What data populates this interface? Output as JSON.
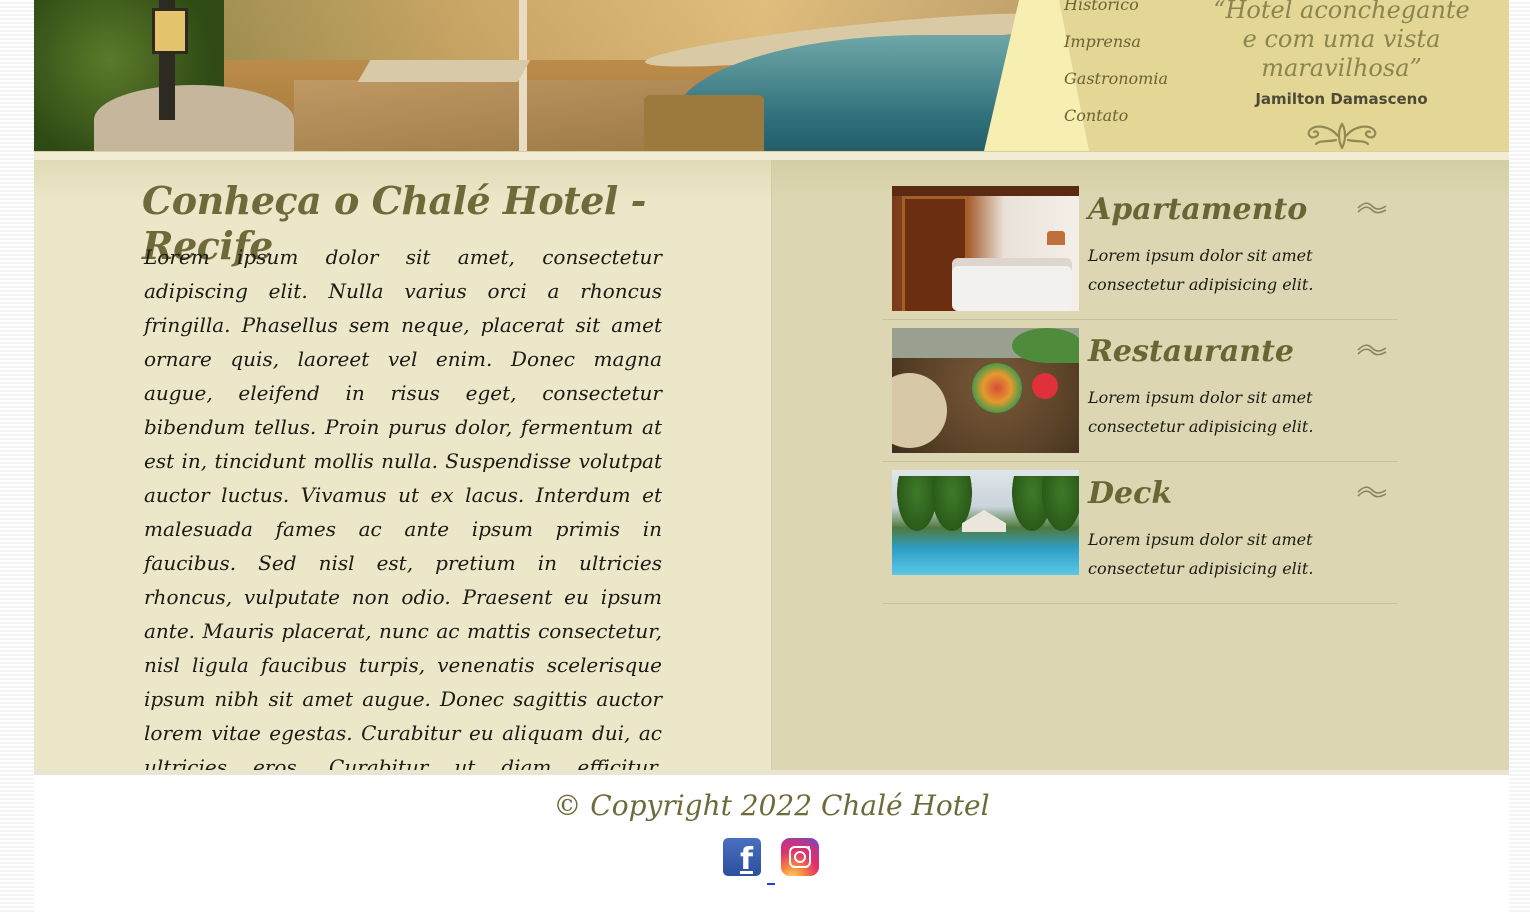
{
  "nav": {
    "items": [
      "Histórico",
      "Imprensa",
      "Gastronomia",
      "Contato"
    ]
  },
  "header": {
    "quote": "“Hotel aconchegante\ne com uma vista\nmaravilhosa”",
    "author": "Jamilton Damasceno"
  },
  "main": {
    "title": "Conheça o Chalé Hotel - Recife",
    "text": "Lorem ipsum dolor sit amet, consectetur adipiscing elit. Nulla varius orci a rhoncus fringilla. Phasellus sem neque, placerat sit amet ornare quis, laoreet vel enim. Donec magna augue, eleifend in risus eget, consectetur bibendum tellus. Proin purus dolor, fermentum at est in, tincidunt mollis nulla. Suspendisse volutpat auctor luctus. Vivamus ut ex lacus. Interdum et malesuada fames ac ante ipsum primis in faucibus. Sed nisl est, pretium in ultricies rhoncus, vulputate non odio. Praesent eu ipsum ante. Mauris placerat, nunc ac mattis consectetur, nisl ligula faucibus turpis, venenatis scelerisque ipsum nibh sit amet augue. Donec sagittis auctor lorem vitae egestas. Curabitur eu aliquam dui, ac ultricies eros. Curabitur ut diam efficitur, scelerisque elit eget, varius sapien. Maecenas nec massa enim."
  },
  "cards": [
    {
      "title": "Apartamento",
      "text": "Lorem ipsum dolor sit amet consectetur adipisicing elit."
    },
    {
      "title": "Restaurante",
      "text": "Lorem ipsum dolor sit amet consectetur adipisicing elit."
    },
    {
      "title": "Deck",
      "text": "Lorem ipsum dolor sit amet consectetur adipisicing elit."
    }
  ],
  "footer": {
    "copyright": "© Copyright 2022 Chalé Hotel",
    "social": [
      "facebook-icon",
      "instagram-icon"
    ]
  },
  "colors": {
    "title_olive": "#6f6a3a",
    "left_panel": "#ece7c9",
    "right_panel": "#dcd7b2",
    "header_gold": "#e4d795"
  }
}
